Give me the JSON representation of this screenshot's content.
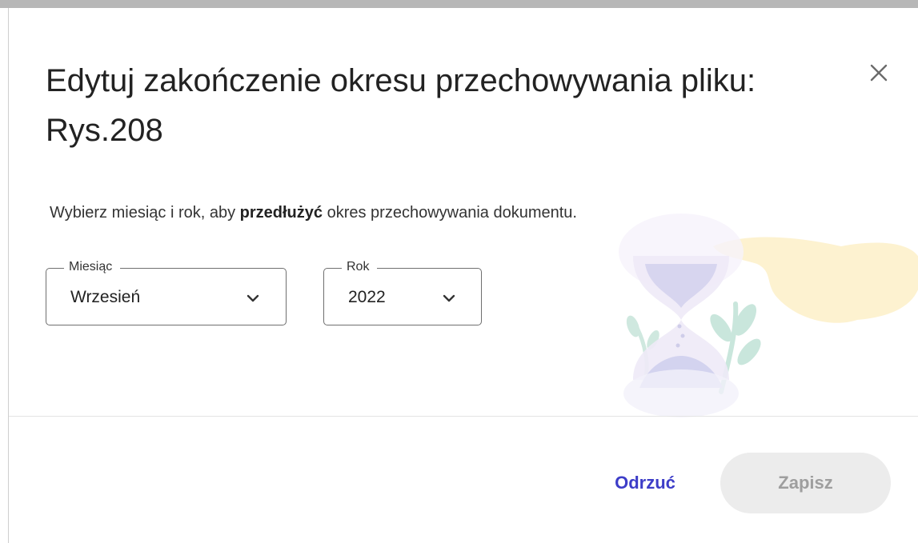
{
  "dialog": {
    "title": "Edytuj zakończenie okresu przechowywania pliku: Rys.208",
    "description_before": "Wybierz miesiąc i rok, aby ",
    "description_bold": "przedłużyć",
    "description_after": " okres przechowywania dokumentu.",
    "close_icon": "close-icon"
  },
  "month_select": {
    "label": "Miesiąc",
    "value": "Wrzesień",
    "icon": "chevron-down-icon"
  },
  "year_select": {
    "label": "Rok",
    "value": "2022",
    "icon": "chevron-down-icon"
  },
  "actions": {
    "discard_label": "Odrzuć",
    "save_label": "Zapisz",
    "save_enabled": false
  },
  "colors": {
    "accent": "#3d3dc8",
    "disabled_bg": "#ececec",
    "disabled_text": "#9e9e9e"
  }
}
